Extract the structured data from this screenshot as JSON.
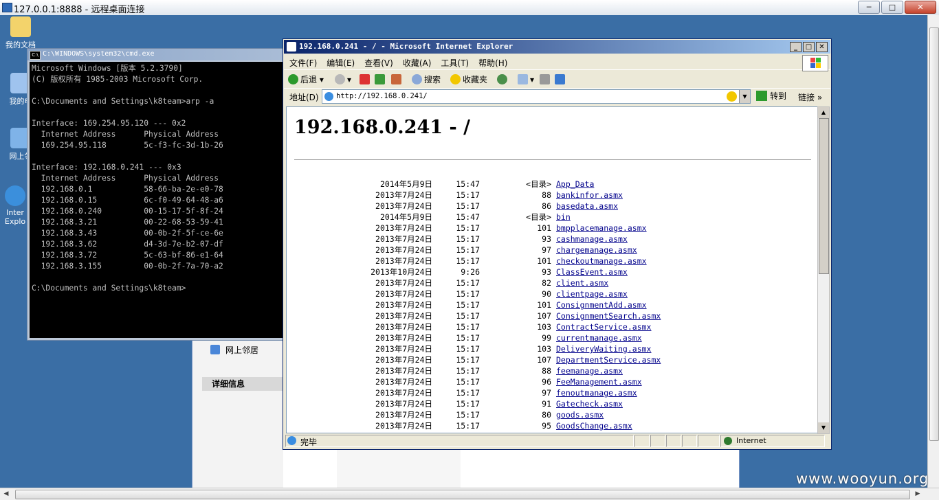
{
  "rdp": {
    "title": "127.0.0.1:8888 - 远程桌面连接",
    "min": "─",
    "max": "□",
    "close": "✕"
  },
  "desktop_icons": [
    {
      "label": "我的文档"
    },
    {
      "label": "我的电"
    },
    {
      "label": "网上邻"
    },
    {
      "label": "Inter Explo"
    }
  ],
  "explorer": {
    "network_label": "网上邻居",
    "details_header": "详细信息"
  },
  "cmd": {
    "title": "C:\\WINDOWS\\system32\\cmd.exe",
    "icon_label": "C:\\",
    "lines": [
      "Microsoft Windows [版本 5.2.3790]",
      "(C) 版权所有 1985-2003 Microsoft Corp.",
      "",
      "C:\\Documents and Settings\\k8team>arp -a",
      "",
      "Interface: 169.254.95.120 --- 0x2",
      "  Internet Address      Physical Address",
      "  169.254.95.118        5c-f3-fc-3d-1b-26",
      "",
      "Interface: 192.168.0.241 --- 0x3",
      "  Internet Address      Physical Address",
      "  192.168.0.1           58-66-ba-2e-e0-78",
      "  192.168.0.15          6c-f0-49-64-48-a6",
      "  192.168.0.240         00-15-17-5f-8f-24",
      "  192.168.3.21          00-22-68-53-59-41",
      "  192.168.3.43          00-0b-2f-5f-ce-6e",
      "  192.168.3.62          d4-3d-7e-b2-07-df",
      "  192.168.3.72          5c-63-bf-86-e1-64",
      "  192.168.3.155         00-0b-2f-7a-70-a2",
      "",
      "C:\\Documents and Settings\\k8team>"
    ]
  },
  "ie": {
    "title": "192.168.0.241 - / - Microsoft Internet Explorer",
    "menu": [
      "文件(F)",
      "编辑(E)",
      "查看(V)",
      "收藏(A)",
      "工具(T)",
      "帮助(H)"
    ],
    "toolbar": {
      "back": "后退",
      "search": "搜索",
      "favorites": "收藏夹"
    },
    "address_label": "地址(D)",
    "url": "http://192.168.0.241/",
    "go": "转到",
    "links": "链接",
    "heading": "192.168.0.241 - /",
    "status": "完毕",
    "zone": "Internet",
    "listing": [
      {
        "date": "2014年5月9日",
        "time": "15:47",
        "size": "<目录>",
        "name": "App_Data"
      },
      {
        "date": "2013年7月24日",
        "time": "15:17",
        "size": "88",
        "name": "bankinfor.asmx"
      },
      {
        "date": "2013年7月24日",
        "time": "15:17",
        "size": "86",
        "name": "basedata.asmx"
      },
      {
        "date": "2014年5月9日",
        "time": "15:47",
        "size": "<目录>",
        "name": "bin"
      },
      {
        "date": "2013年7月24日",
        "time": "15:17",
        "size": "101",
        "name": "bmpplacemanage.asmx"
      },
      {
        "date": "2013年7月24日",
        "time": "15:17",
        "size": "93",
        "name": "cashmanage.asmx"
      },
      {
        "date": "2013年7月24日",
        "time": "15:17",
        "size": "97",
        "name": "chargemanage.asmx"
      },
      {
        "date": "2013年7月24日",
        "time": "15:17",
        "size": "101",
        "name": "checkoutmanage.asmx"
      },
      {
        "date": "2013年10月24日",
        "time": "9:26",
        "size": "93",
        "name": "ClassEvent.asmx"
      },
      {
        "date": "2013年7月24日",
        "time": "15:17",
        "size": "82",
        "name": "client.asmx"
      },
      {
        "date": "2013年7月24日",
        "time": "15:17",
        "size": "90",
        "name": "clientpage.asmx"
      },
      {
        "date": "2013年7月24日",
        "time": "15:17",
        "size": "101",
        "name": "ConsignmentAdd.asmx"
      },
      {
        "date": "2013年7月24日",
        "time": "15:17",
        "size": "107",
        "name": "ConsignmentSearch.asmx"
      },
      {
        "date": "2013年7月24日",
        "time": "15:17",
        "size": "103",
        "name": "ContractService.asmx"
      },
      {
        "date": "2013年7月24日",
        "time": "15:17",
        "size": "99",
        "name": "currentmanage.asmx"
      },
      {
        "date": "2013年7月24日",
        "time": "15:17",
        "size": "103",
        "name": "DeliveryWaiting.asmx"
      },
      {
        "date": "2013年7月24日",
        "time": "15:17",
        "size": "107",
        "name": "DepartmentService.asmx"
      },
      {
        "date": "2013年7月24日",
        "time": "15:17",
        "size": "88",
        "name": "feemanage.asmx"
      },
      {
        "date": "2013年7月24日",
        "time": "15:17",
        "size": "96",
        "name": "FeeManagement.asmx"
      },
      {
        "date": "2013年7月24日",
        "time": "15:17",
        "size": "97",
        "name": "fenoutmanage.asmx"
      },
      {
        "date": "2013年7月24日",
        "time": "15:17",
        "size": "91",
        "name": "Gatecheck.asmx"
      },
      {
        "date": "2013年7月24日",
        "time": "15:17",
        "size": "80",
        "name": "goods.asmx"
      },
      {
        "date": "2013年7月24日",
        "time": "15:17",
        "size": "95",
        "name": "GoodsChange.asmx"
      }
    ]
  },
  "watermark": "www.wooyun.org",
  "colors": {
    "desktop": "#3a6ea5",
    "link": "#00008b",
    "ie_title": "#0a246a"
  }
}
